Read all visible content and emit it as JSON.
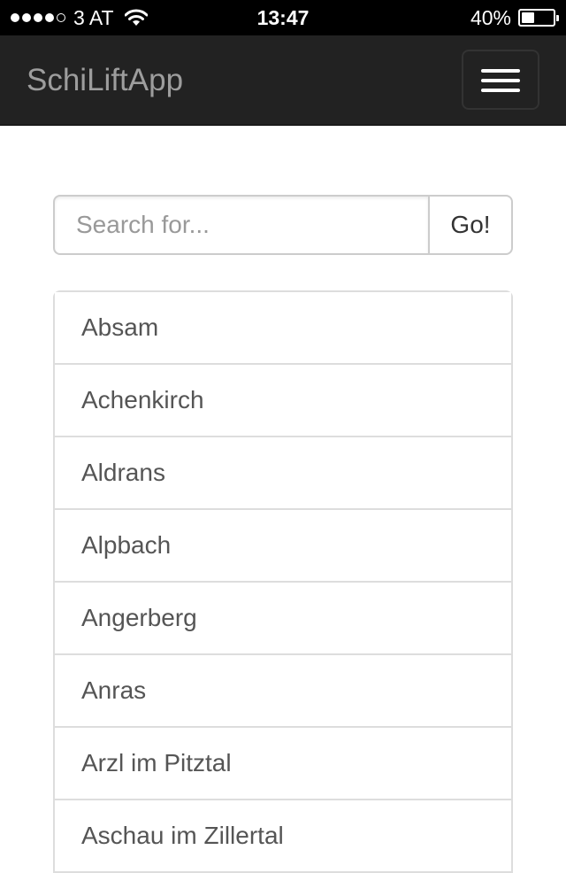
{
  "status_bar": {
    "carrier": "3 AT",
    "time": "13:47",
    "battery": "40%",
    "battery_level": 0.4,
    "signal_bars_filled": 4,
    "signal_bars_total": 5,
    "icons": {
      "signal": "signal-strength-icon",
      "wifi": "wifi-icon",
      "battery": "battery-icon"
    }
  },
  "navbar": {
    "brand": "SchiLiftApp",
    "toggle_icon": "hamburger-menu-icon",
    "background": "#222222",
    "brand_color": "#9d9d9d"
  },
  "search": {
    "placeholder": "Search for...",
    "value": "",
    "button_label": "Go!"
  },
  "locations": [
    {
      "label": "Absam"
    },
    {
      "label": "Achenkirch"
    },
    {
      "label": "Aldrans"
    },
    {
      "label": "Alpbach"
    },
    {
      "label": "Angerberg"
    },
    {
      "label": "Anras"
    },
    {
      "label": "Arzl im Pitztal"
    },
    {
      "label": "Aschau im Zillertal"
    }
  ]
}
